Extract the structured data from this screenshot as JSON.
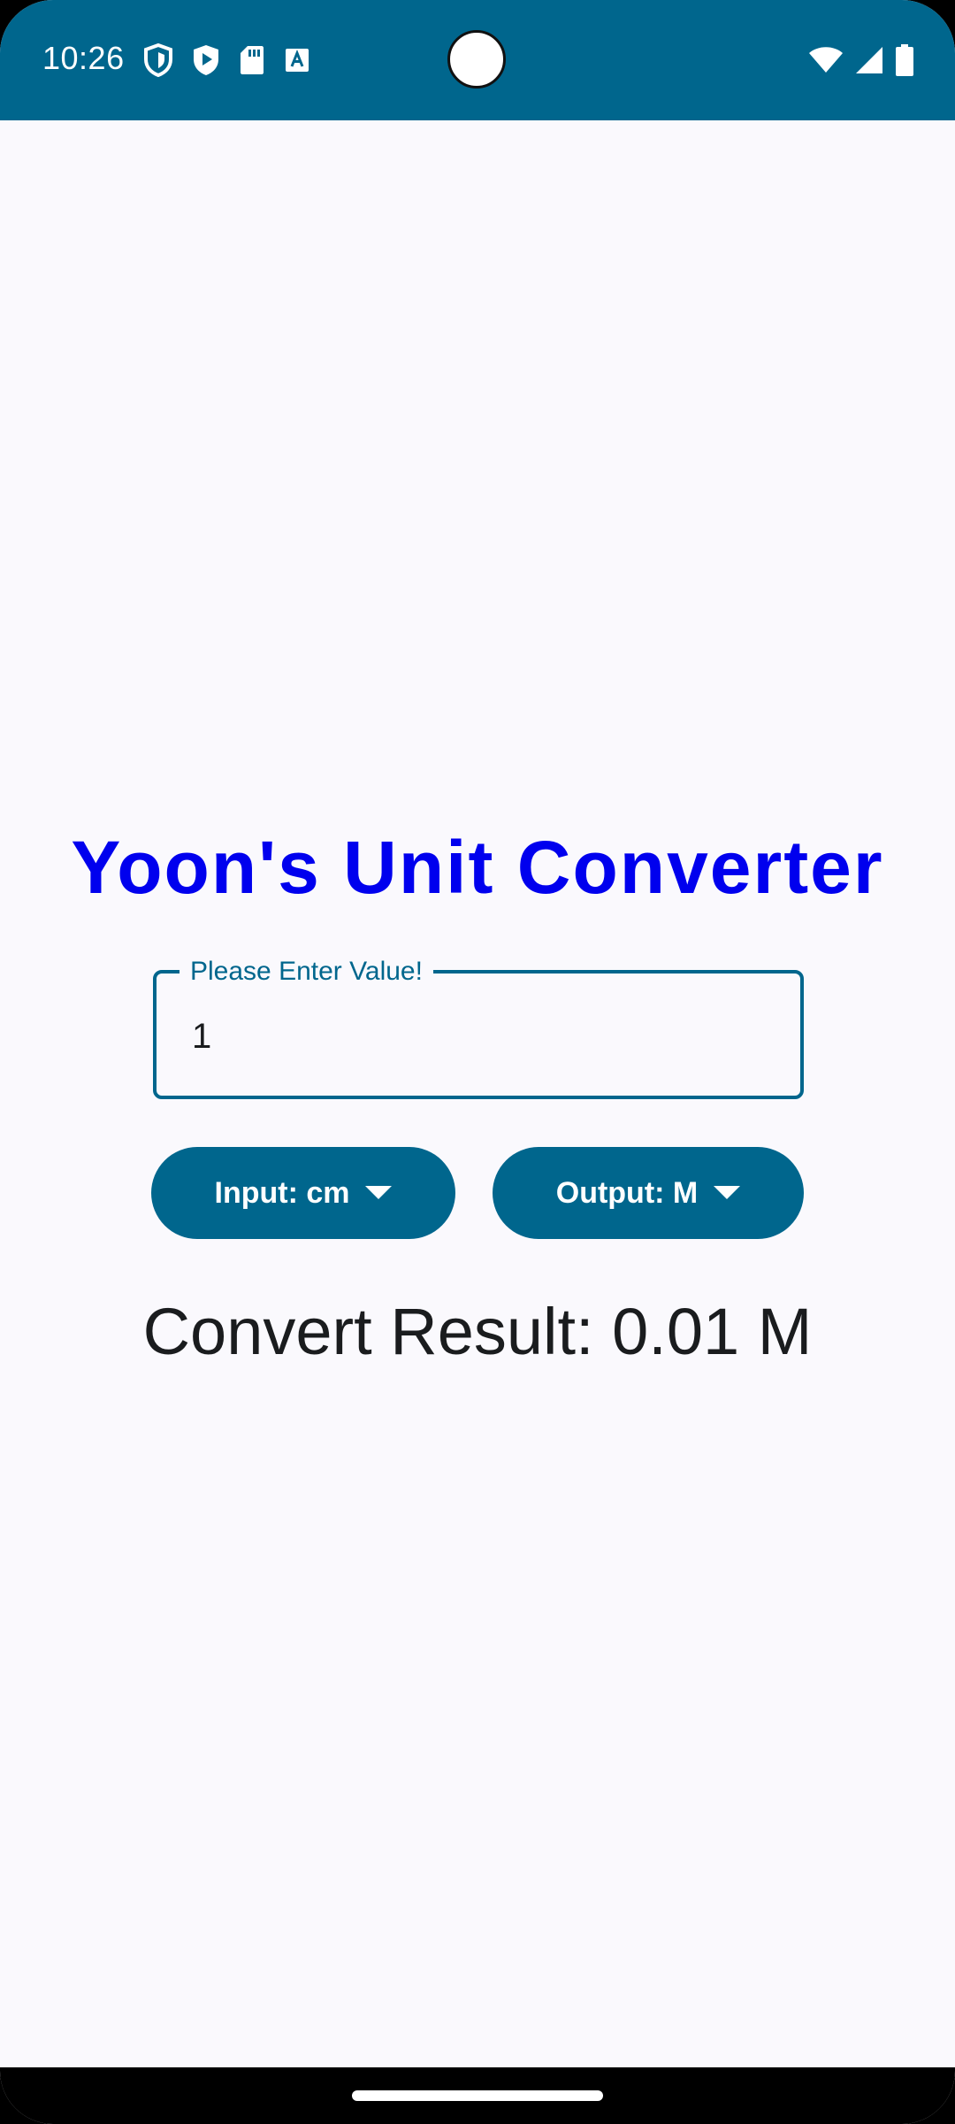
{
  "status_bar": {
    "time": "10:26",
    "background": "#00668d",
    "left_icons": [
      "shield-outline-icon",
      "play-shield-icon",
      "sd-card-icon",
      "text-a-icon"
    ],
    "right_icons": [
      "wifi-icon",
      "signal-icon",
      "battery-icon"
    ]
  },
  "app": {
    "title": "Yoon's Unit Converter",
    "title_color": "#0000ee",
    "accent": "#00668d"
  },
  "value_field": {
    "label": "Please Enter Value!",
    "value": "1"
  },
  "input_dropdown": {
    "label": "Input: cm",
    "icon": "arrow-drop-down-icon"
  },
  "output_dropdown": {
    "label": "Output: M",
    "icon": "arrow-drop-down-icon"
  },
  "result": {
    "text": "Convert Result: 0.01 M"
  }
}
